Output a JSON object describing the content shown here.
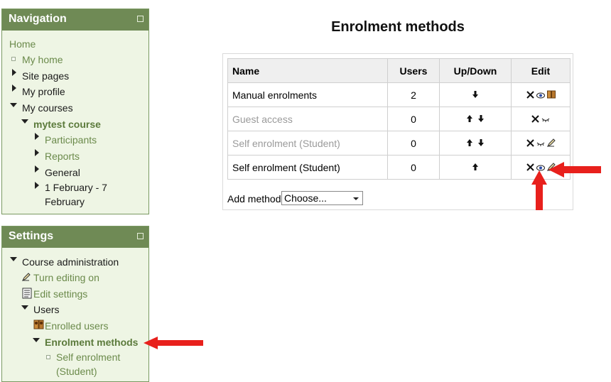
{
  "navigation": {
    "title": "Navigation",
    "items": {
      "home": "Home",
      "my_home": "My home",
      "site_pages": "Site pages",
      "my_profile": "My profile",
      "my_courses": "My courses",
      "course": "mytest course",
      "participants": "Participants",
      "reports": "Reports",
      "general": "General",
      "week": "1 February - 7 February"
    }
  },
  "settings": {
    "title": "Settings",
    "items": {
      "course_admin": "Course administration",
      "turn_editing_on": "Turn editing on",
      "edit_settings": "Edit settings",
      "users": "Users",
      "enrolled_users": "Enrolled users",
      "enrolment_methods": "Enrolment methods",
      "self_enrolment": "Self enrolment (Student)"
    }
  },
  "main": {
    "title": "Enrolment methods",
    "table": {
      "headers": [
        "Name",
        "Users",
        "Up/Down",
        "Edit"
      ],
      "rows": [
        {
          "name": "Manual enrolments",
          "users": "2",
          "enabled": true
        },
        {
          "name": "Guest access",
          "users": "0",
          "enabled": false
        },
        {
          "name": "Self enrolment (Student)",
          "users": "0",
          "enabled": false
        },
        {
          "name": "Self enrolment (Student)",
          "users": "0",
          "enabled": true
        }
      ]
    },
    "add_method": {
      "label": "Add method",
      "selected": "Choose..."
    }
  },
  "colors": {
    "block_header": "#6f8a55",
    "block_bg": "#eef5e4",
    "link": "#6b8a4b",
    "annotation_arrow": "#e8201c"
  }
}
